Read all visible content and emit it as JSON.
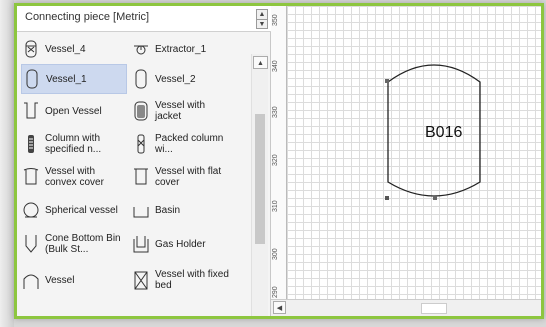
{
  "panel": {
    "title": "Connecting piece [Metric]",
    "items": [
      {
        "label": "Vessel_4",
        "icon": "vessel-icon"
      },
      {
        "label": "Extractor_1",
        "icon": "extractor-icon"
      },
      {
        "label": "Vessel_1",
        "icon": "vessel-icon"
      },
      {
        "label": "Vessel_2",
        "icon": "vessel-icon"
      },
      {
        "label": "Open Vessel",
        "icon": "open-vessel-icon"
      },
      {
        "label": "Vessel with jacket",
        "icon": "jacketed-vessel-icon"
      },
      {
        "label": "Column with specified n...",
        "icon": "column-icon"
      },
      {
        "label": "Packed column wi...",
        "icon": "packed-column-icon"
      },
      {
        "label": "Vessel with convex cover",
        "icon": "convex-vessel-icon"
      },
      {
        "label": "Vessel with flat cover",
        "icon": "flat-cover-vessel-icon"
      },
      {
        "label": "Spherical vessel",
        "icon": "spherical-vessel-icon"
      },
      {
        "label": "Basin",
        "icon": "basin-icon"
      },
      {
        "label": "Cone Bottom Bin (Bulk St...",
        "icon": "cone-bin-icon"
      },
      {
        "label": "Gas Holder",
        "icon": "gas-holder-icon"
      },
      {
        "label": "Vessel",
        "icon": "vessel-icon"
      },
      {
        "label": "Vessel with fixed bed",
        "icon": "fixed-bed-vessel-icon"
      }
    ],
    "selected": "Vessel_1"
  },
  "ruler": {
    "labels": [
      "350",
      "340",
      "330",
      "320",
      "310",
      "300",
      "290"
    ]
  },
  "canvas": {
    "shape_tag": "B016"
  }
}
